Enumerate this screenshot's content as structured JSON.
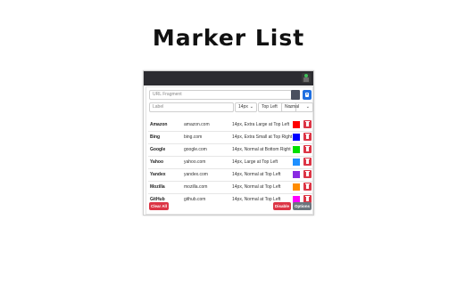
{
  "page": {
    "title": "Marker List"
  },
  "form": {
    "url_placeholder": "URL Fragment",
    "label_placeholder": "Label",
    "size_value": "14px",
    "position_value": "Top Left",
    "style_value": "Normal",
    "swatch_color": "#4a4f5e",
    "save_color": "#1f6fe0"
  },
  "markers": [
    {
      "name": "Amazon",
      "domain": "amazon.com",
      "desc": "14px, Extra Large at Top Left",
      "color": "#ff0000"
    },
    {
      "name": "Bing",
      "domain": "bing.com",
      "desc": "14px, Extra Small at Top Right",
      "color": "#0000ff"
    },
    {
      "name": "Google",
      "domain": "google.com",
      "desc": "14px, Normal at Bottom Right",
      "color": "#00e000"
    },
    {
      "name": "Yahoo",
      "domain": "yahoo.com",
      "desc": "14px, Large at Top Left",
      "color": "#1e90ff"
    },
    {
      "name": "Yandex",
      "domain": "yandex.com",
      "desc": "14px, Normal at Top Left",
      "color": "#8a2be2"
    },
    {
      "name": "Mozilla",
      "domain": "mozilla.com",
      "desc": "14px, Normal at Top Left",
      "color": "#ff8c00"
    },
    {
      "name": "GitHub",
      "domain": "github.com",
      "desc": "14px, Normal at Top Left",
      "color": "#ff00ff"
    }
  ],
  "footer": {
    "clear_label": "Clear All",
    "disable_label": "Disable",
    "options_label": "Options"
  }
}
